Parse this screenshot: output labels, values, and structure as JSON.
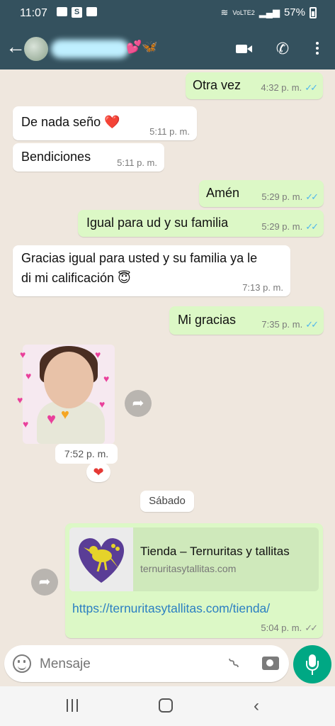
{
  "status_bar": {
    "time": "11:07",
    "battery": "57%",
    "network": "VoLTE2"
  },
  "header": {
    "contact_emojis": "💕🦋"
  },
  "messages": [
    {
      "dir": "out",
      "text": "Otra vez",
      "time": "4:32 p. m.",
      "ticks": "✓✓"
    },
    {
      "dir": "in",
      "text": "De nada seño ❤️",
      "time": "5:11 p. m."
    },
    {
      "dir": "in",
      "text": "Bendiciones",
      "time": "5:11 p. m."
    },
    {
      "dir": "out",
      "text": "Amén",
      "time": "5:29 p. m.",
      "ticks": "✓✓"
    },
    {
      "dir": "out",
      "text": "Igual para ud y su familia",
      "time": "5:29 p. m.",
      "ticks": "✓✓"
    },
    {
      "dir": "in",
      "line1": "Gracias igual para usted y su familia ya le",
      "line2": "di mi calificación 😇",
      "time": "7:13 p. m."
    },
    {
      "dir": "out",
      "text": "Mi gracias",
      "time": "7:35 p. m.",
      "ticks": "✓✓"
    }
  ],
  "sticker": {
    "time": "7:52 p. m.",
    "reaction": "❤"
  },
  "date_divider": "Sábado",
  "link_message": {
    "preview_title": "Tienda – Ternuritas y tallitas",
    "preview_domain": "ternuritasytallitas.com",
    "url": "https://ternuritasytallitas.com/tienda/",
    "time": "5:04 p. m.",
    "ticks": "✓✓"
  },
  "composer": {
    "placeholder": "Mensaje"
  },
  "colors": {
    "header": "#34515e",
    "outgoing": "#dcf8c6",
    "incoming": "#ffffff",
    "read_ticks": "#4fb6ec",
    "mic": "#00a884"
  }
}
